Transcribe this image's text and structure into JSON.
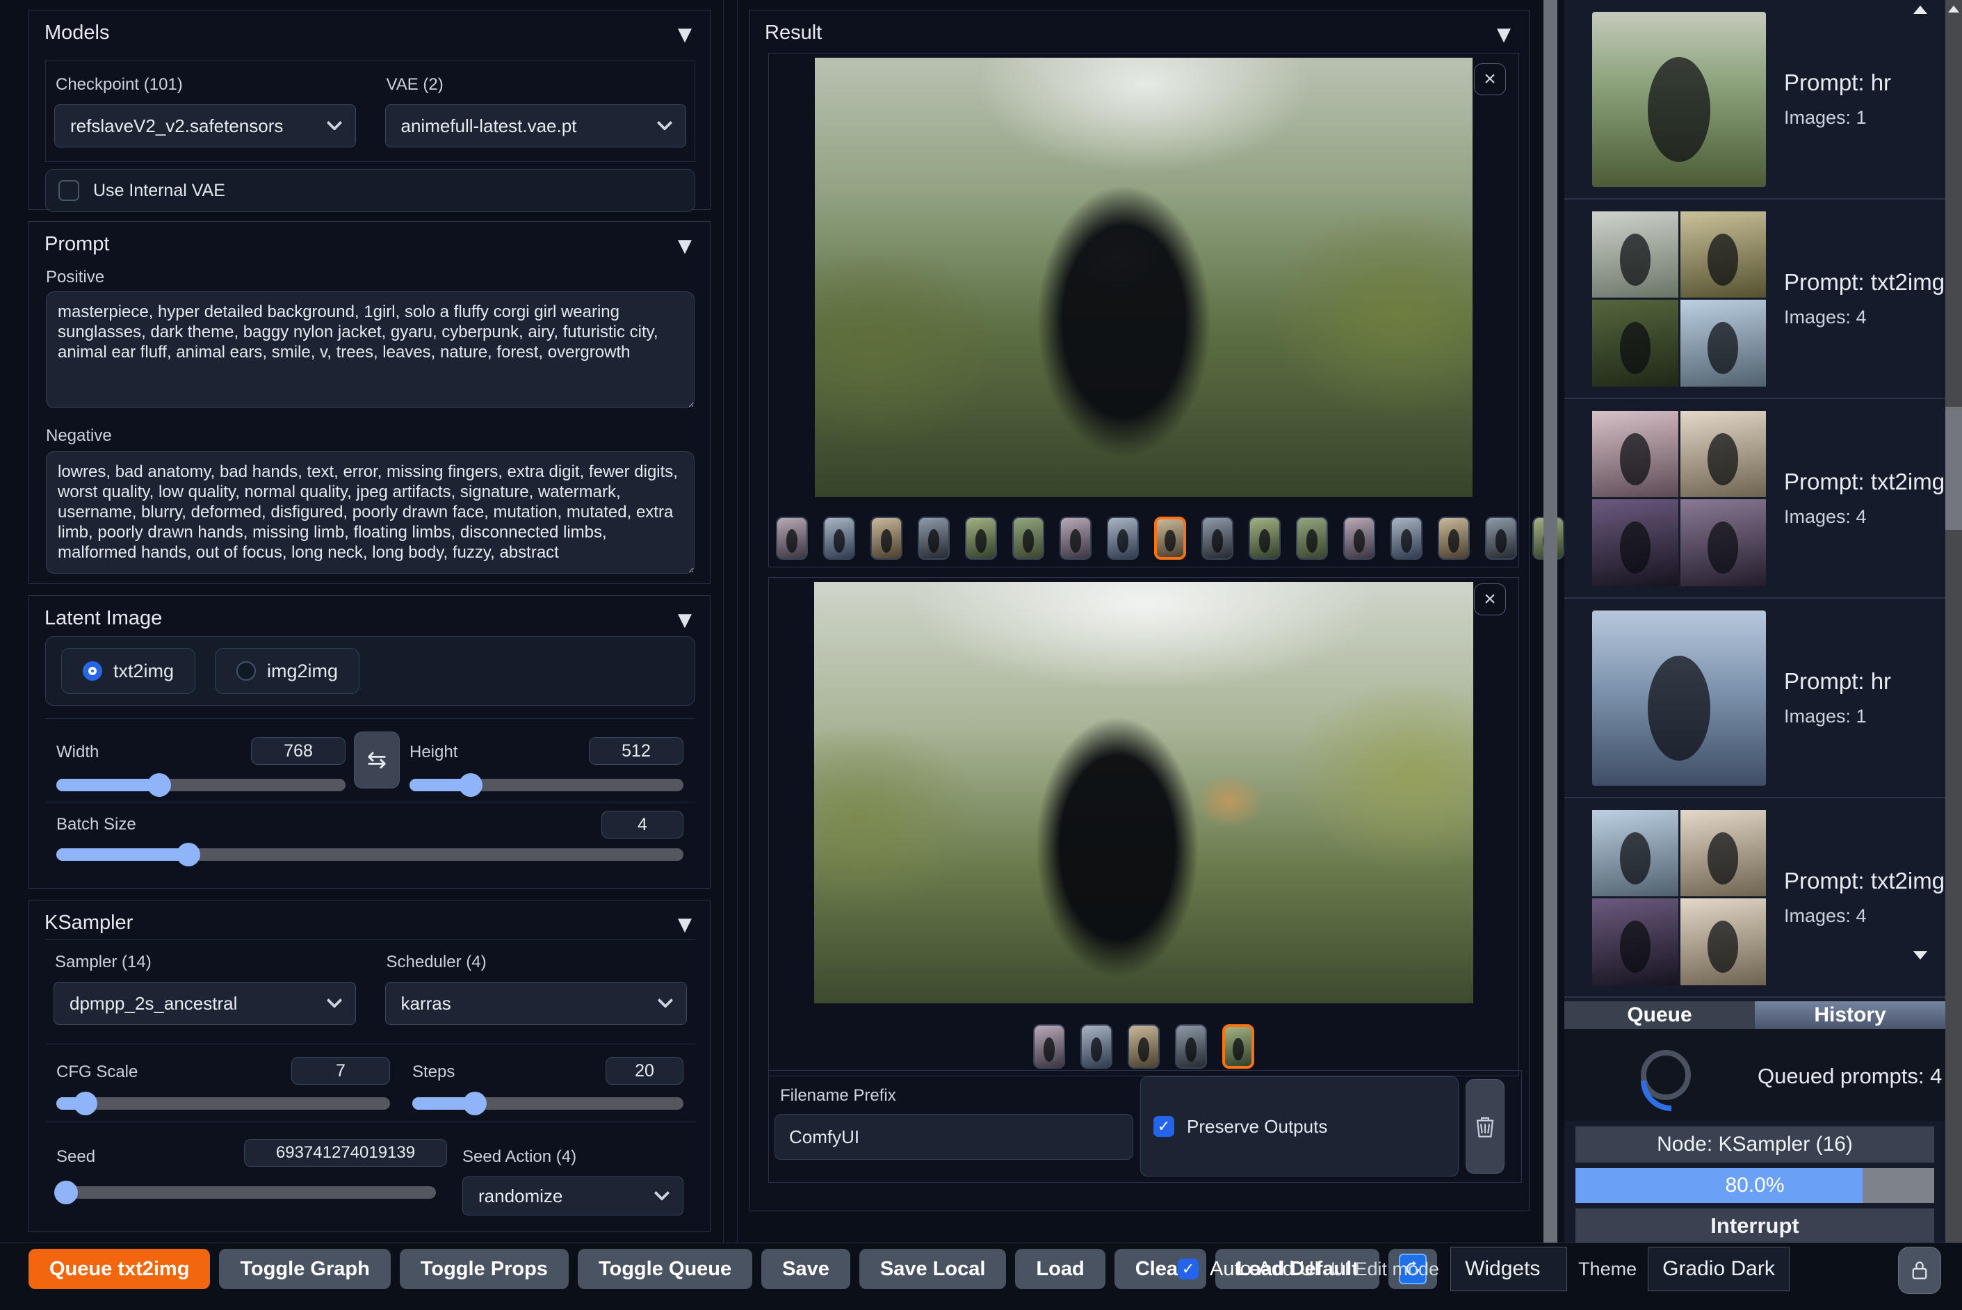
{
  "models": {
    "title": "Models",
    "checkpoint_label": "Checkpoint (101)",
    "checkpoint_value": "refslaveV2_v2.safetensors",
    "vae_label": "VAE (2)",
    "vae_value": "animefull-latest.vae.pt",
    "use_internal_vae_label": "Use Internal VAE"
  },
  "prompt": {
    "title": "Prompt",
    "positive_label": "Positive",
    "positive_value": "masterpiece, hyper detailed background, 1girl, solo a fluffy corgi girl wearing sunglasses, dark theme, baggy nylon jacket, gyaru, cyberpunk, airy, futuristic city, animal ear fluff, animal ears, smile, v, trees, leaves, nature, forest, overgrowth",
    "negative_label": "Negative",
    "negative_value": "lowres, bad anatomy, bad hands, text, error, missing fingers, extra digit, fewer digits, worst quality, low quality, normal quality, jpeg artifacts, signature, watermark, username, blurry, deformed, disfigured, poorly drawn face, mutation, mutated, extra limb, poorly drawn hands, missing limb, floating limbs, disconnected limbs, malformed hands, out of focus, long neck, long body, fuzzy, abstract"
  },
  "latent": {
    "title": "Latent Image",
    "mode_txt2img": "txt2img",
    "mode_img2img": "img2img",
    "width_label": "Width",
    "width_value": "768",
    "height_label": "Height",
    "height_value": "512",
    "batch_label": "Batch Size",
    "batch_value": "4"
  },
  "ksampler": {
    "title": "KSampler",
    "sampler_label": "Sampler (14)",
    "sampler_value": "dpmpp_2s_ancestral",
    "scheduler_label": "Scheduler (4)",
    "scheduler_value": "karras",
    "cfg_label": "CFG Scale",
    "cfg_value": "7",
    "steps_label": "Steps",
    "steps_value": "20",
    "seed_label": "Seed",
    "seed_value": "693741274019139",
    "seed_action_label": "Seed Action (4)",
    "seed_action_value": "randomize"
  },
  "result": {
    "title": "Result",
    "gallery1": {
      "count": 17,
      "selected": 9
    },
    "gallery2": {
      "count": 5,
      "selected": 5
    },
    "filename_prefix_label": "Filename Prefix",
    "filename_prefix_value": "ComfyUI",
    "preserve_outputs_label": "Preserve Outputs"
  },
  "history": {
    "items": [
      {
        "prompt": "Prompt: hr",
        "images": "Images: 1"
      },
      {
        "prompt": "Prompt: txt2img",
        "images": "Images: 4"
      },
      {
        "prompt": "Prompt: txt2img",
        "images": "Images: 4"
      },
      {
        "prompt": "Prompt: hr",
        "images": "Images: 1"
      },
      {
        "prompt": "Prompt: txt2img",
        "images": "Images: 4"
      }
    ]
  },
  "queue_panel": {
    "tab_queue": "Queue",
    "tab_history": "History",
    "queued_text": "Queued prompts: 4",
    "node_text": "Node: KSampler (16)",
    "progress_text": "80.0%",
    "progress_value": 80,
    "interrupt_label": "Interrupt"
  },
  "toolbar": {
    "buttons": [
      "Queue txt2img",
      "Toggle Graph",
      "Toggle Props",
      "Toggle Queue",
      "Save",
      "Save Local",
      "Load",
      "Clear",
      "Load Default"
    ],
    "auto_add_ui_label": "Auto-Add UI",
    "ui_edit_mode_label": "UI Edit mode",
    "widgets_value": "Widgets",
    "theme_label": "Theme",
    "theme_value": "Gradio Dark"
  },
  "colors": {
    "accent_orange": "#f2670e",
    "accent_blue": "#2563eb",
    "progress_blue": "#6aa1f7"
  }
}
